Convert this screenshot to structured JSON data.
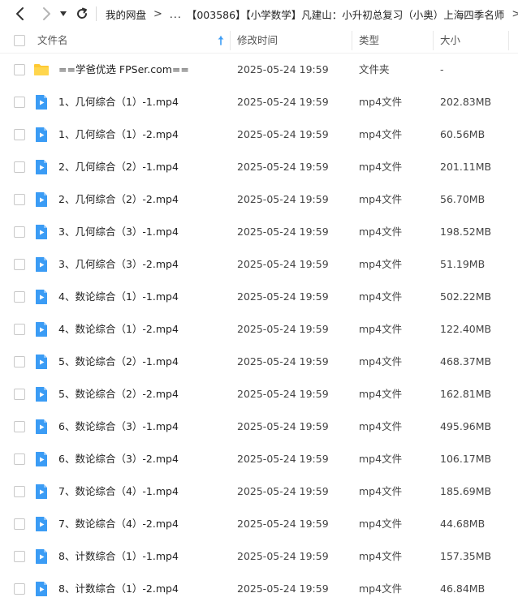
{
  "nav": {
    "back_icon": "chevron-left-icon",
    "forward_icon": "chevron-right-icon",
    "dropdown_icon": "caret-down-icon",
    "refresh_icon": "refresh-icon"
  },
  "breadcrumb": {
    "root": "我的网盘",
    "ellipsis": "...",
    "current": "【003586】【小学数学】凡建山：小升初总复习（小奥）上海四季名师"
  },
  "columns": {
    "name": "文件名",
    "mtime": "修改时间",
    "type": "类型",
    "size": "大小"
  },
  "colors": {
    "accent": "#3b9cf5",
    "folder": "#ffc933",
    "video": "#3b9cf5"
  },
  "files": [
    {
      "name": "==学爸优选 FPSer.com==",
      "mtime": "2025-05-24 19:59",
      "type": "文件夹",
      "size": "-",
      "kind": "folder"
    },
    {
      "name": "1、几何综合（1）-1.mp4",
      "mtime": "2025-05-24 19:59",
      "type": "mp4文件",
      "size": "202.83MB",
      "kind": "video"
    },
    {
      "name": "1、几何综合（1）-2.mp4",
      "mtime": "2025-05-24 19:59",
      "type": "mp4文件",
      "size": "60.56MB",
      "kind": "video"
    },
    {
      "name": "2、几何综合（2）-1.mp4",
      "mtime": "2025-05-24 19:59",
      "type": "mp4文件",
      "size": "201.11MB",
      "kind": "video"
    },
    {
      "name": "2、几何综合（2）-2.mp4",
      "mtime": "2025-05-24 19:59",
      "type": "mp4文件",
      "size": "56.70MB",
      "kind": "video"
    },
    {
      "name": "3、几何综合（3）-1.mp4",
      "mtime": "2025-05-24 19:59",
      "type": "mp4文件",
      "size": "198.52MB",
      "kind": "video"
    },
    {
      "name": "3、几何综合（3）-2.mp4",
      "mtime": "2025-05-24 19:59",
      "type": "mp4文件",
      "size": "51.19MB",
      "kind": "video"
    },
    {
      "name": "4、数论综合（1）-1.mp4",
      "mtime": "2025-05-24 19:59",
      "type": "mp4文件",
      "size": "502.22MB",
      "kind": "video"
    },
    {
      "name": "4、数论综合（1）-2.mp4",
      "mtime": "2025-05-24 19:59",
      "type": "mp4文件",
      "size": "122.40MB",
      "kind": "video"
    },
    {
      "name": "5、数论综合（2）-1.mp4",
      "mtime": "2025-05-24 19:59",
      "type": "mp4文件",
      "size": "468.37MB",
      "kind": "video"
    },
    {
      "name": "5、数论综合（2）-2.mp4",
      "mtime": "2025-05-24 19:59",
      "type": "mp4文件",
      "size": "162.81MB",
      "kind": "video"
    },
    {
      "name": "6、数论综合（3）-1.mp4",
      "mtime": "2025-05-24 19:59",
      "type": "mp4文件",
      "size": "495.96MB",
      "kind": "video"
    },
    {
      "name": "6、数论综合（3）-2.mp4",
      "mtime": "2025-05-24 19:59",
      "type": "mp4文件",
      "size": "106.17MB",
      "kind": "video"
    },
    {
      "name": "7、数论综合（4）-1.mp4",
      "mtime": "2025-05-24 19:59",
      "type": "mp4文件",
      "size": "185.69MB",
      "kind": "video"
    },
    {
      "name": "7、数论综合（4）-2.mp4",
      "mtime": "2025-05-24 19:59",
      "type": "mp4文件",
      "size": "44.68MB",
      "kind": "video"
    },
    {
      "name": "8、计数综合（1）-1.mp4",
      "mtime": "2025-05-24 19:59",
      "type": "mp4文件",
      "size": "157.35MB",
      "kind": "video"
    },
    {
      "name": "8、计数综合（1）-2.mp4",
      "mtime": "2025-05-24 19:59",
      "type": "mp4文件",
      "size": "46.84MB",
      "kind": "video"
    }
  ]
}
